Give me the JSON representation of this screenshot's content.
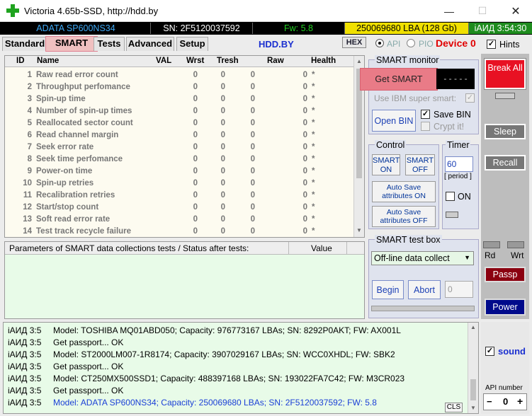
{
  "window": {
    "title": "Victoria 4.65b-SSD, http://hdd.by"
  },
  "infobar": {
    "model": "ADATA SP600NS34",
    "sn": "SN: 2F5120037592",
    "fw": "Fw: 5.8",
    "lba": "250069680 LBA (128 Gb)",
    "time": "iАИД 3:54:30"
  },
  "tabs": [
    "Standard",
    "SMART",
    "Tests",
    "Advanced",
    "Setup"
  ],
  "site": "HDD.BY",
  "hex_label": "HEX",
  "api_label": "API",
  "pio_label": "PIO",
  "device_label": "Device 0",
  "hints_label": "Hints",
  "smart_table": {
    "headers": [
      "ID",
      "Name",
      "VAL",
      "Wrst",
      "Tresh",
      "Raw",
      "Health"
    ],
    "rows": [
      {
        "id": "1",
        "name": "Raw read error count",
        "val": "0",
        "wrst": "0",
        "tresh": "0",
        "raw": "0",
        "health": "*"
      },
      {
        "id": "2",
        "name": "Throughput perfomance",
        "val": "0",
        "wrst": "0",
        "tresh": "0",
        "raw": "0",
        "health": "*"
      },
      {
        "id": "3",
        "name": "Spin-up time",
        "val": "0",
        "wrst": "0",
        "tresh": "0",
        "raw": "0",
        "health": "*"
      },
      {
        "id": "4",
        "name": "Number of spin-up times",
        "val": "0",
        "wrst": "0",
        "tresh": "0",
        "raw": "0",
        "health": "*"
      },
      {
        "id": "5",
        "name": "Reallocated sector count",
        "val": "0",
        "wrst": "0",
        "tresh": "0",
        "raw": "0",
        "health": "*"
      },
      {
        "id": "6",
        "name": "Read channel margin",
        "val": "0",
        "wrst": "0",
        "tresh": "0",
        "raw": "0",
        "health": "*"
      },
      {
        "id": "7",
        "name": "Seek error rate",
        "val": "0",
        "wrst": "0",
        "tresh": "0",
        "raw": "0",
        "health": "*"
      },
      {
        "id": "8",
        "name": "Seek time perfomance",
        "val": "0",
        "wrst": "0",
        "tresh": "0",
        "raw": "0",
        "health": "*"
      },
      {
        "id": "9",
        "name": "Power-on time",
        "val": "0",
        "wrst": "0",
        "tresh": "0",
        "raw": "0",
        "health": "*"
      },
      {
        "id": "10",
        "name": "Spin-up retries",
        "val": "0",
        "wrst": "0",
        "tresh": "0",
        "raw": "0",
        "health": "*"
      },
      {
        "id": "11",
        "name": "Recalibration retries",
        "val": "0",
        "wrst": "0",
        "tresh": "0",
        "raw": "0",
        "health": "*"
      },
      {
        "id": "12",
        "name": "Start/stop count",
        "val": "0",
        "wrst": "0",
        "tresh": "0",
        "raw": "0",
        "health": "*"
      },
      {
        "id": "13",
        "name": "Soft read error rate",
        "val": "0",
        "wrst": "0",
        "tresh": "0",
        "raw": "0",
        "health": "*"
      },
      {
        "id": "14",
        "name": "Test track recycle failure",
        "val": "0",
        "wrst": "0",
        "tresh": "0",
        "raw": "0",
        "health": "*"
      }
    ]
  },
  "params_table": {
    "col1": "Parameters of SMART data collections tests / Status after tests:",
    "col2": "Value"
  },
  "smart_monitor": {
    "title": "SMART monitor",
    "get_smart": "Get SMART",
    "display": "- - - - -",
    "use_ibm": "Use IBM super smart:",
    "open_bin": "Open BIN",
    "save_bin": "Save BIN",
    "crypt": "Crypt it!"
  },
  "control": {
    "title": "Control",
    "smart_on": "SMART ON",
    "smart_off": "SMART OFF",
    "autosave_on": "Auto Save attributes ON",
    "autosave_off": "Auto Save attributes OFF"
  },
  "timer": {
    "title": "Timer",
    "value": "60",
    "period": "[ period ]",
    "on": "ON"
  },
  "test_box": {
    "title": "SMART test box",
    "selected": "Off-line data collect",
    "begin": "Begin",
    "abort": "Abort",
    "value": "0"
  },
  "right_panel": {
    "break_all": "Break All",
    "sleep": "Sleep",
    "recall": "Recall",
    "rd": "Rd",
    "wrt": "Wrt",
    "passp": "Passp",
    "power": "Power",
    "sound": "sound",
    "api_number": "API number",
    "api_value": "0"
  },
  "log": [
    {
      "prefix": "iАИД 3:5",
      "text": "Model: TOSHIBA MQ01ABD050; Capacity: 976773167 LBAs; SN: 8292P0AKT; FW: AX001L",
      "color": "#000000"
    },
    {
      "prefix": "iАИД 3:5",
      "text": "Get passport... OK",
      "color": "#000000"
    },
    {
      "prefix": "iАИД 3:5",
      "text": "Model: ST2000LM007-1R8174; Capacity: 3907029167 LBAs; SN: WCC0XHDL; FW: SBK2",
      "color": "#000000"
    },
    {
      "prefix": "iАИД 3:5",
      "text": "Get passport... OK",
      "color": "#000000"
    },
    {
      "prefix": "iАИД 3:5",
      "text": "Model: CT250MX500SSD1; Capacity: 488397168 LBAs; SN: 193022FA7C42; FW: M3CR023",
      "color": "#000000"
    },
    {
      "prefix": "iАИД 3:5",
      "text": "Get passport... OK",
      "color": "#000000"
    },
    {
      "prefix": "iАИД 3:5",
      "text": "Model: ADATA SP600NS34; Capacity: 250069680 LBAs; SN: 2F5120037592; FW: 5.8",
      "color": "#1a3fd6"
    }
  ],
  "cls_label": "CLS",
  "colors": {
    "infobar_model": "#3fa9f5",
    "infobar_green": "#22d022",
    "infobar_yellow": "#f0e000",
    "device": "#e00000",
    "break_red": "#e81123"
  }
}
